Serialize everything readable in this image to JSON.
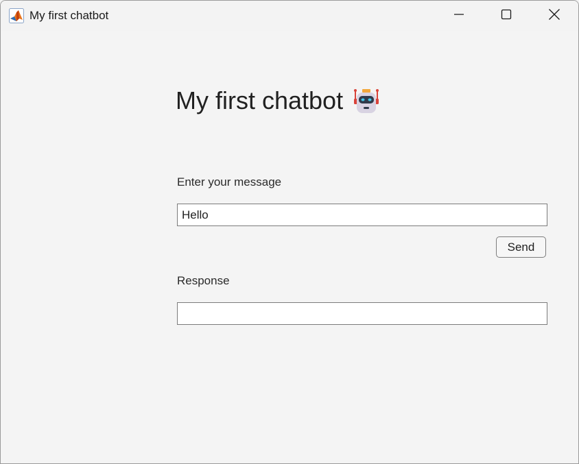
{
  "window": {
    "title": "My first chatbot",
    "icon": "matlab-icon",
    "controls": {
      "minimize": "minimize-icon",
      "maximize": "maximize-icon",
      "close": "close-icon"
    }
  },
  "main": {
    "heading": "My first chatbot",
    "heading_icon": "robot-icon",
    "message_label": "Enter your message",
    "message_value": "Hello",
    "send_label": "Send",
    "response_label": "Response",
    "response_value": ""
  },
  "colors": {
    "background": "#f4f4f4",
    "field_border": "#7a7a7a",
    "text": "#212121"
  }
}
